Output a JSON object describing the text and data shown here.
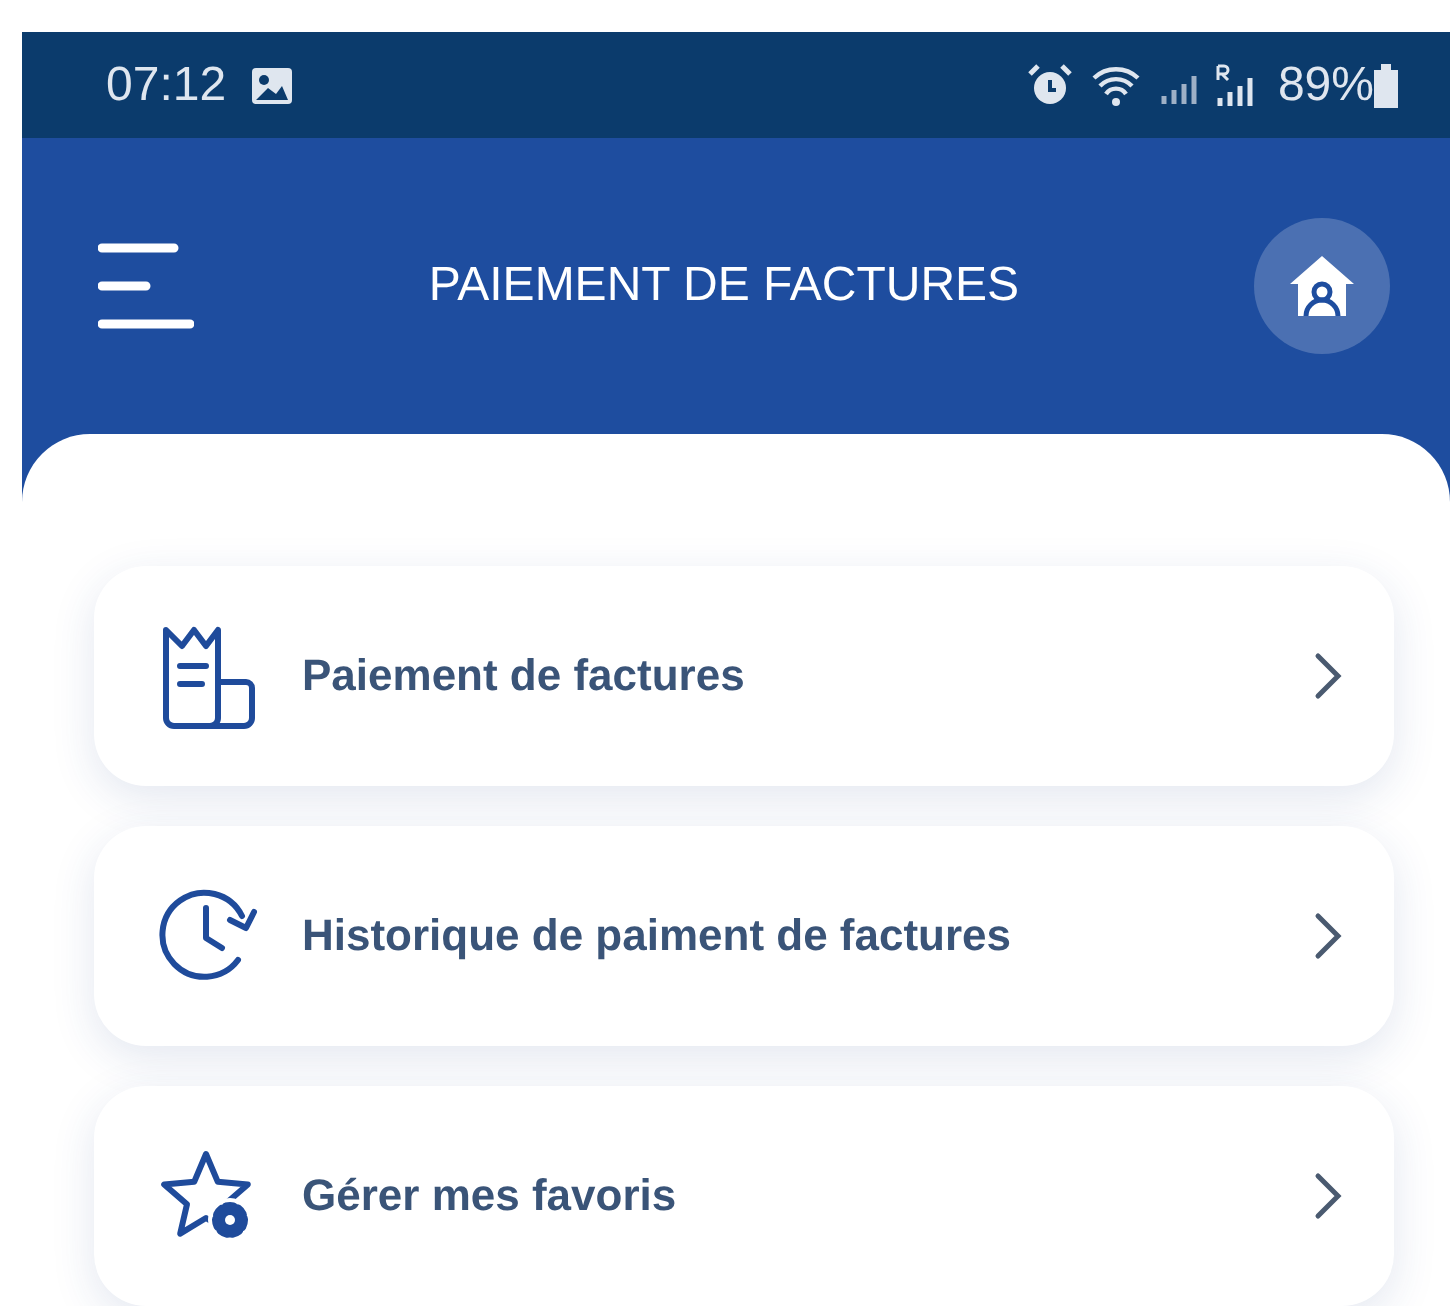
{
  "status_bar": {
    "time": "07:12",
    "battery": "89%"
  },
  "header": {
    "title": "PAIEMENT DE FACTURES"
  },
  "menu_items": [
    {
      "kind": "invoice",
      "label": "Paiement de factures"
    },
    {
      "kind": "history",
      "label": "Historique de paiment de factures"
    },
    {
      "kind": "favorites",
      "label": "Gérer mes favoris"
    }
  ]
}
